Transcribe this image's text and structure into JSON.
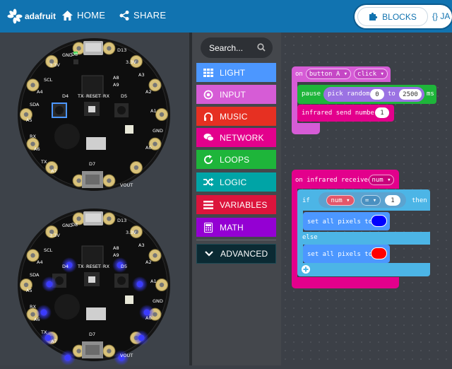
{
  "header": {
    "logo_text": "adafruit",
    "home_label": "HOME",
    "share_label": "SHARE",
    "blocks_label": "BLOCKS",
    "js_label": "{} JA"
  },
  "toolbox": {
    "search_placeholder": "Search...",
    "categories": [
      {
        "label": "LIGHT",
        "color": "#4c97ff",
        "icon": "grid-icon"
      },
      {
        "label": "INPUT",
        "color": "#d65cd6",
        "icon": "target-icon"
      },
      {
        "label": "MUSIC",
        "color": "#e63022",
        "icon": "headphones-icon"
      },
      {
        "label": "NETWORK",
        "color": "#e3008c",
        "icon": "chat-icon"
      },
      {
        "label": "LOOPS",
        "color": "#1eb53a",
        "icon": "loop-icon"
      },
      {
        "label": "LOGIC",
        "color": "#00a4a6",
        "icon": "shuffle-icon"
      },
      {
        "label": "VARIABLES",
        "color": "#dc143c",
        "icon": "list-icon"
      },
      {
        "label": "MATH",
        "color": "#9400d3",
        "icon": "calculator-icon"
      },
      {
        "label": "ADVANCED",
        "color": "#0b2a33",
        "icon": "chevron-down-icon"
      }
    ]
  },
  "simulator": {
    "pin_labels": [
      "D8",
      "D13",
      "3.3V",
      "A3",
      "A2",
      "A1",
      "GND",
      "A0",
      "VOUT",
      "D7",
      "A7",
      "TX",
      "A6",
      "RX",
      "A5",
      "SDA",
      "A4",
      "SCL",
      "GND",
      "3.3V",
      "D4",
      "D5",
      "TX",
      "RESET",
      "RX",
      "A9",
      "A8"
    ],
    "board_top": {
      "leds": "off"
    },
    "board_bottom": {
      "leds": "blue",
      "led_color": "#3b3bff"
    }
  },
  "blocks": {
    "event1": {
      "on": "on",
      "button": "button A",
      "action": "click"
    },
    "pause": {
      "label": "pause",
      "random_label": "pick random",
      "from": "0",
      "to_label": "to",
      "to": "2500",
      "unit": "ms"
    },
    "ir_send": {
      "label": "infrared send number",
      "value": "1"
    },
    "event2": {
      "label": "on infrared received",
      "var": "num"
    },
    "if_block": {
      "if_label": "if",
      "var": "num",
      "op": "=",
      "value": "1",
      "then_label": "then",
      "else_label": "else"
    },
    "set1": {
      "label": "set all pixels to",
      "color": "#0000ff"
    },
    "set2": {
      "label": "set all pixels to",
      "color": "#ff0000"
    }
  }
}
